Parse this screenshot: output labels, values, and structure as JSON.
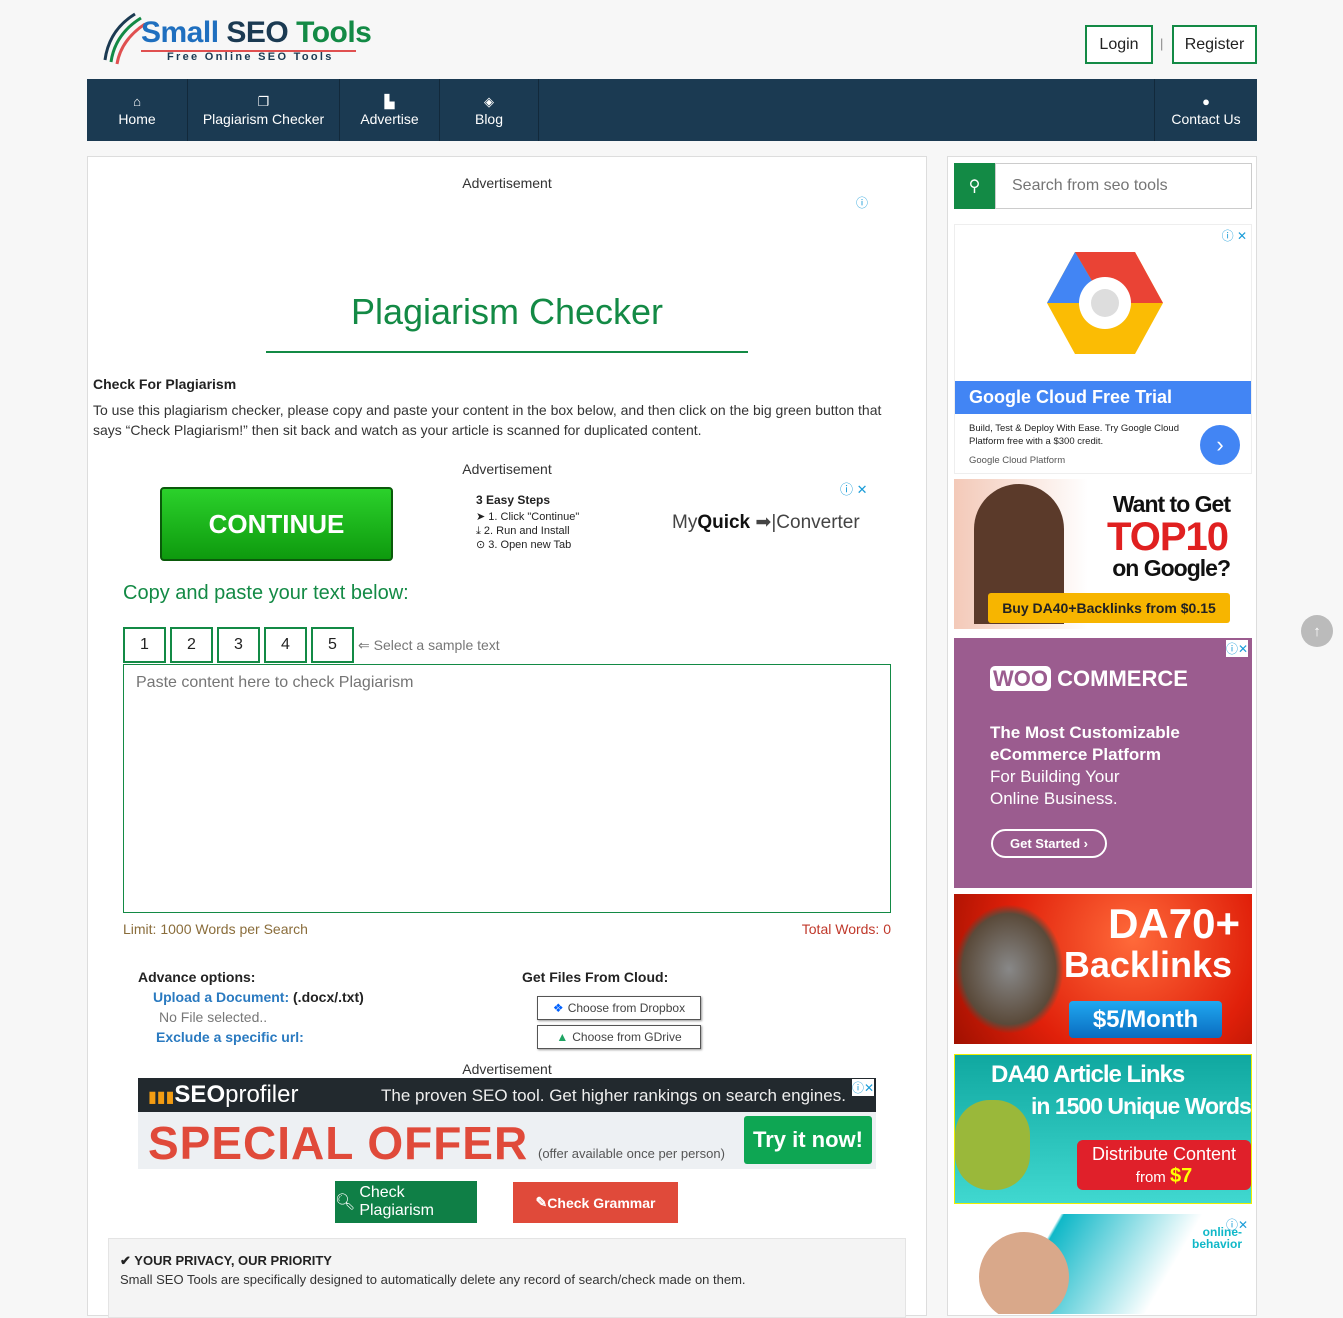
{
  "header": {
    "logo": {
      "word1": "Small",
      "word2": "SEO",
      "word3": "Tools",
      "tagline": "Free Online SEO Tools"
    },
    "login": "Login",
    "separator": "|",
    "register": "Register"
  },
  "nav": {
    "items": [
      {
        "label": "Home",
        "icon": "home-icon"
      },
      {
        "label": "Plagiarism Checker",
        "icon": "copy-icon"
      },
      {
        "label": "Advertise",
        "icon": "advertise-icon"
      },
      {
        "label": "Blog",
        "icon": "tags-icon"
      }
    ],
    "contact": {
      "label": "Contact Us",
      "icon": "map-marker-icon"
    }
  },
  "main": {
    "ad_label": "Advertisement",
    "title": "Plagiarism Checker",
    "intro_heading": "Check For Plagiarism",
    "intro_text": "To use this plagiarism checker, please copy and paste your content in the box below, and then click on the big green button that says “Check Plagiarism!” then sit back and watch as your article is scanned for duplicated content.",
    "ad1": {
      "button": "CONTINUE",
      "steps_title": "3 Easy Steps",
      "steps": [
        "1. Click \"Continue\"",
        "2. Run and Install",
        "3. Open new Tab"
      ],
      "brand_a": "My",
      "brand_b": "Quick",
      "brand_c": "Converter"
    },
    "copy_heading": "Copy and paste your text below:",
    "samples": [
      "1",
      "2",
      "3",
      "4",
      "5"
    ],
    "sample_hint": "⇐ Select a sample text",
    "textarea_placeholder": "Paste content here to check Plagiarism",
    "limit": "Limit: 1000 Words per Search",
    "total_words": "Total Words: 0",
    "advance": {
      "heading": "Advance options:",
      "upload_label": "Upload a Document:",
      "upload_ext": "(.docx/.txt)",
      "no_file": "No File selected..",
      "exclude": "Exclude a specific url:"
    },
    "cloud": {
      "heading": "Get Files From Cloud:",
      "dropbox": "Choose from Dropbox",
      "gdrive": "Choose from GDrive"
    },
    "ad2": {
      "brand_a": "SEO",
      "brand_b": "profiler",
      "tagline": "The proven SEO tool. Get higher rankings on search engines.",
      "offer": "SPECIAL OFFER",
      "note": "(offer available once per person)",
      "cta": "Try it now!"
    },
    "check_plagiarism": "Check Plagiarism",
    "check_grammar": "Check Grammar",
    "privacy": {
      "heading": "YOUR PRIVACY, OUR PRIORITY",
      "text": "Small SEO Tools are specifically designed to automatically delete any record of search/check made on them."
    }
  },
  "sidebar": {
    "search_placeholder": "Search from seo tools",
    "ads": {
      "gcloud": {
        "title": "Google Cloud Free Trial",
        "text": "Build, Test & Deploy With Ease. Try Google Cloud Platform free with a $300 credit.",
        "source": "Google Cloud Platform"
      },
      "top10": {
        "line1": "Want to Get",
        "line2": "TOP10",
        "line3": "on Google?",
        "cta": "Buy DA40+Backlinks from $0.15"
      },
      "woo": {
        "brand_a": "WOO",
        "brand_b": "COMMERCE",
        "bold": "The Most Customizable eCommerce Platform",
        "text": "For Building Your Online Business.",
        "cta": "Get Started"
      },
      "da70": {
        "line1": "DA70+",
        "line2": "Backlinks",
        "cta": "$5/Month"
      },
      "da40": {
        "line1": "DA40 Article Links",
        "line2": "in 1500 Unique Words",
        "cta1": "Distribute Content",
        "cta2a": "from",
        "cta2b": "$7"
      },
      "ob": {
        "brand_a": "online-",
        "brand_b": "behavior"
      }
    }
  },
  "colors": {
    "nav": "#1b3a52",
    "green": "#138a45",
    "red": "#e04a3a",
    "blue": "#4285f4"
  }
}
